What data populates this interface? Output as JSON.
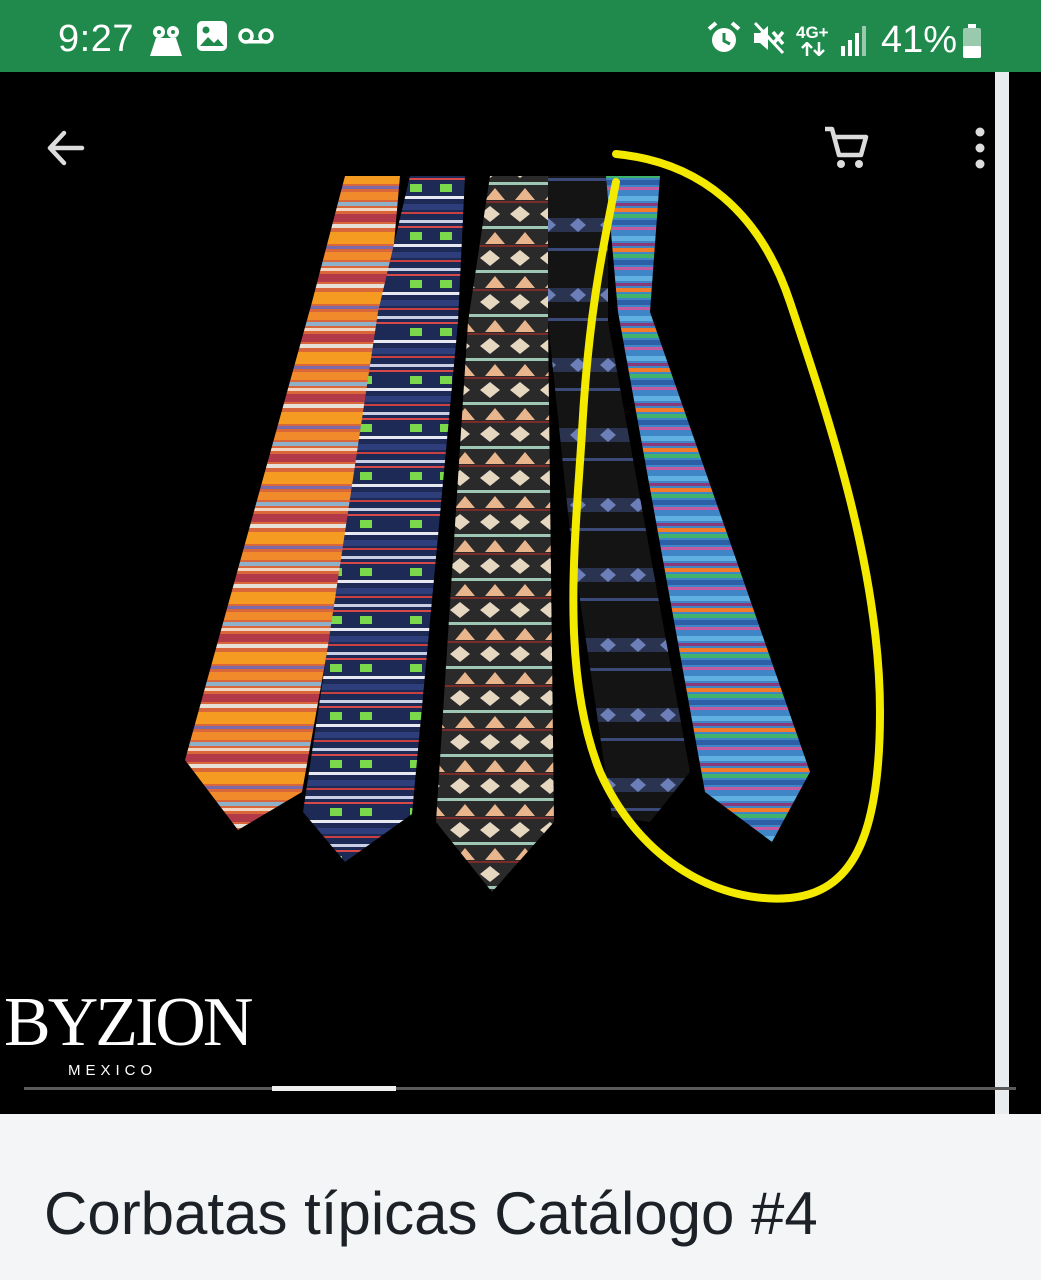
{
  "status_bar": {
    "time": "9:27",
    "left_icons": [
      "notification-app-icon",
      "image-icon",
      "voicemail-icon"
    ],
    "right_icons": [
      "alarm-icon",
      "vibrate-mute-icon",
      "network-4g-plus-icon",
      "signal-icon",
      "battery-icon"
    ],
    "network_label": "4G+",
    "battery_percent": "41%",
    "battery_level": 0.41,
    "color": "#1f8a4c"
  },
  "toolbar": {
    "back_icon": "arrow-left-icon",
    "cart_icon": "shopping-cart-icon",
    "more_icon": "more-vertical-icon"
  },
  "gallery": {
    "brand_name": "BYZION",
    "brand_sub": "MEXICO",
    "page_index": 2,
    "page_count": 8,
    "highlight_color": "#f4ea00"
  },
  "product": {
    "title": "Corbatas típicas Catálogo #4"
  }
}
